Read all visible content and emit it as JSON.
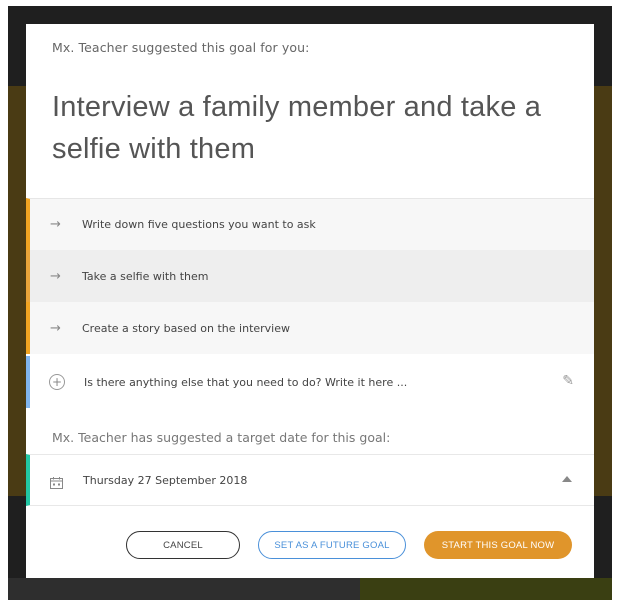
{
  "modal": {
    "suggestion_text": "Mx. Teacher suggested this goal for you:",
    "goal_title": "Interview a family member and take a selfie with them",
    "steps": [
      {
        "label": "Write down five questions you want to ask",
        "icon": "arrow-right-icon"
      },
      {
        "label": "Take a selfie with them",
        "icon": "arrow-right-icon"
      },
      {
        "label": "Create a story based on the interview",
        "icon": "arrow-right-icon"
      }
    ],
    "add_step_placeholder": "Is there anything else that you need to do? Write it here ...",
    "target_date_text": "Mx. Teacher has suggested a target date for this goal:",
    "target_date": "Thursday 27 September 2018",
    "buttons": {
      "cancel": "CANCEL",
      "future": "SET AS A FUTURE GOAL",
      "start": "START THIS GOAL NOW"
    }
  },
  "colors": {
    "step_accent": "#f0a322",
    "add_accent": "#7fb4ef",
    "date_accent": "#22c7a4",
    "start_button": "#e0952b",
    "future_button": "#4a90d9"
  }
}
